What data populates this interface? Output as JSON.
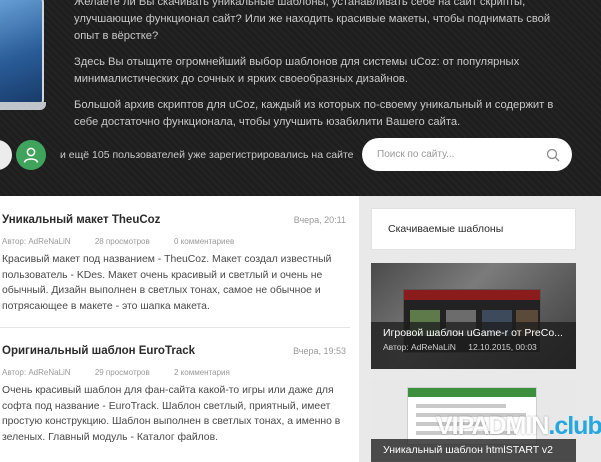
{
  "hero": {
    "paragraphs": [
      "Желаете ли Вы скачивать уникальные шаблоны, устанавливать себе на сайт скрипты, улучшающие функционал сайт? Или же находить красивые макеты, чтобы поднимать свой опыт в вёрстке?",
      "Здесь Вы отыщите огромнейший выбор шаблонов для системы uCoz: от популярных минималистических до сочных и ярких своеобразных дизайнов.",
      "Большой архив скриптов для uCoz, каждый из которых по-своему уникальный и содержит в себе достаточно функционала, чтобы улучшить юзабилити Вашего сайта."
    ],
    "registered_text": "и ещё 105 пользователей уже зарегистрировались на сайте",
    "search_placeholder": "Поиск по сайту..."
  },
  "articles": [
    {
      "title": "Уникальный макет TheuCoz",
      "date": "Вчера, 20:11",
      "author": "Автор: AdReNaLiN",
      "views": "28 просмотров",
      "comments": "0 комментариев",
      "body": "Красивый макет под названием - TheuCoz. Макет создал известный пользователь - KDes. Макет очень красивый и светлый и очень не обычный. Дизайн выполнен в светлых тонах, самое не обычное и потрясающее в макете - это шапка макета."
    },
    {
      "title": "Оригинальный шаблон EuroTrack",
      "date": "Вчера, 19:53",
      "author": "Автор: AdReNaLiN",
      "views": "29 просмотров",
      "comments": "2 комментария",
      "body": "Очень красивый шаблон для фан-сайта какой-то игры или даже для софта под название - EuroTrack. Шаблон светлый, приятный, имеет простую конструкцию. Шаблон выполнен в светлых тонах, а именно в зеленых. Главный модуль - Каталог файлов."
    }
  ],
  "sidebar": {
    "header": "Скачиваемые шаблоны",
    "cards": [
      {
        "title": "Игровой шаблон uGame-r от PreCo...",
        "author": "Автор: AdReNaLiN",
        "date": "12.10.2015, 00:03"
      },
      {
        "title": "Уникальный шаблон htmlSTART v2"
      }
    ]
  },
  "watermark": {
    "part1": "VIPADMIN",
    "part2": ".club"
  },
  "colors": {
    "hero_bg": "#1e1e1e",
    "accent_green": "#3fa35b",
    "watermark_blue": "#27a7e0"
  }
}
